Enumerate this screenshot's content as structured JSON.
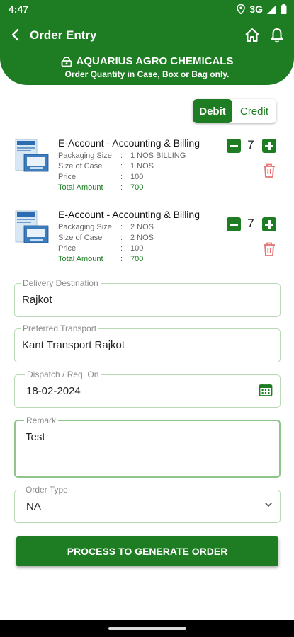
{
  "status_bar": {
    "time": "4:47",
    "network": "3G"
  },
  "header": {
    "title": "Order Entry",
    "company": "AQUARIUS AGRO CHEMICALS",
    "note": "Order Quantity in Case, Box or Bag only.",
    "icons": [
      "back-arrow-icon",
      "home-icon",
      "bell-icon",
      "lock-icon"
    ]
  },
  "toggle": {
    "debit_label": "Debit",
    "credit_label": "Credit",
    "selected": "Debit"
  },
  "spec_labels": {
    "packaging": "Packaging Size",
    "case_size": "Size of Case",
    "price": "Price",
    "total": "Total Amount",
    "colon": ":"
  },
  "products": [
    {
      "name": "E-Account - Accounting & Billing",
      "packaging_size": "1 NOS BILLING",
      "size_of_case": "1 NOS",
      "price": "100",
      "total_amount": "700",
      "quantity": "7"
    },
    {
      "name": "E-Account - Accounting & Billing",
      "packaging_size": "2 NOS",
      "size_of_case": "2 NOS",
      "price": "100",
      "total_amount": "700",
      "quantity": "7"
    }
  ],
  "form": {
    "delivery_destination": {
      "label": "Delivery Destination",
      "value": "Rajkot"
    },
    "preferred_transport": {
      "label": "Preferred Transport",
      "value": "Kant Transport Rajkot"
    },
    "dispatch_date": {
      "label": "Dispatch / Req. On",
      "value": "18-02-2024"
    },
    "remark": {
      "label": "Remark",
      "value": "Test"
    },
    "order_type": {
      "label": "Order Type",
      "value": "NA"
    }
  },
  "submit_label": "PROCESS TO GENERATE ORDER",
  "colors": {
    "primary": "#1e7d22",
    "field_border": "#b9d9b6",
    "delete": "#e57373"
  }
}
